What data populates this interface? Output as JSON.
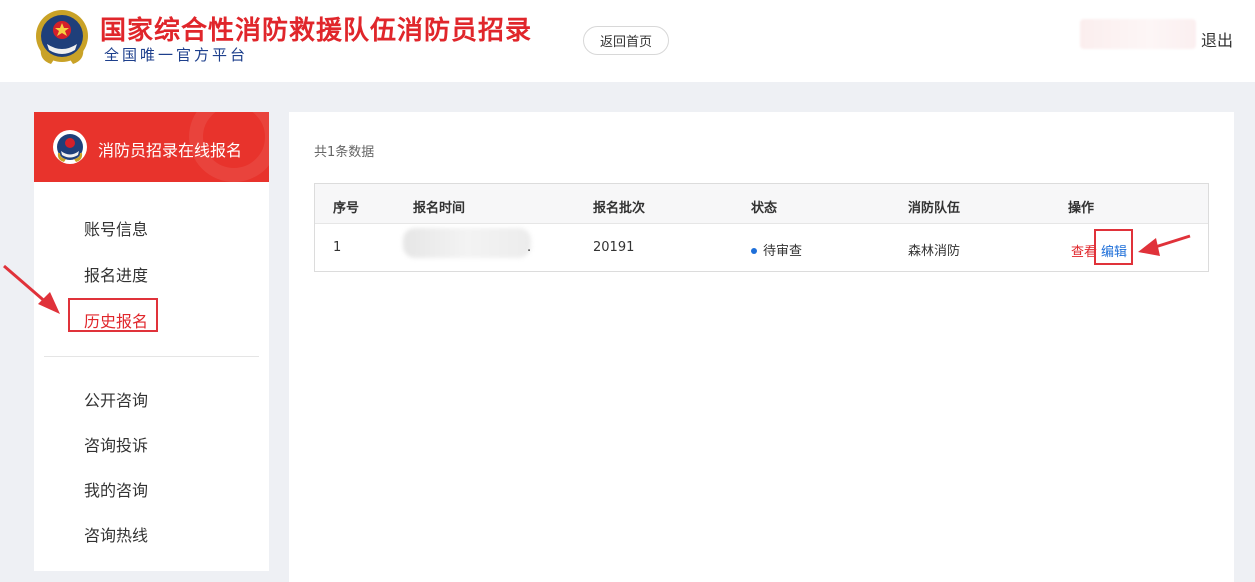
{
  "header": {
    "site_title": "国家综合性消防救援队伍消防员招录",
    "site_subtitle": "全国唯一官方平台",
    "home_button": "返回首页",
    "logout": "退出"
  },
  "sidebar": {
    "title": "消防员招录在线报名",
    "group1": [
      {
        "label": "账号信息",
        "active": false
      },
      {
        "label": "报名进度",
        "active": false
      },
      {
        "label": "历史报名",
        "active": true
      }
    ],
    "group2": [
      {
        "label": "公开咨询"
      },
      {
        "label": "咨询投诉"
      },
      {
        "label": "我的咨询"
      },
      {
        "label": "咨询热线"
      }
    ]
  },
  "main": {
    "count_text": "共1条数据",
    "columns": [
      "序号",
      "报名时间",
      "报名批次",
      "状态",
      "消防队伍",
      "操作"
    ],
    "rows": [
      {
        "index": "1",
        "time_suffix": ".",
        "batch": "20191",
        "status": "待审查",
        "team": "森林消防",
        "actions": {
          "view": "查看",
          "edit": "编辑"
        }
      }
    ]
  },
  "colors": {
    "brand_red": "#e0262b",
    "sidebar_head": "#e8332c",
    "link_blue": "#1e6fd9",
    "background": "#eef0f4"
  }
}
